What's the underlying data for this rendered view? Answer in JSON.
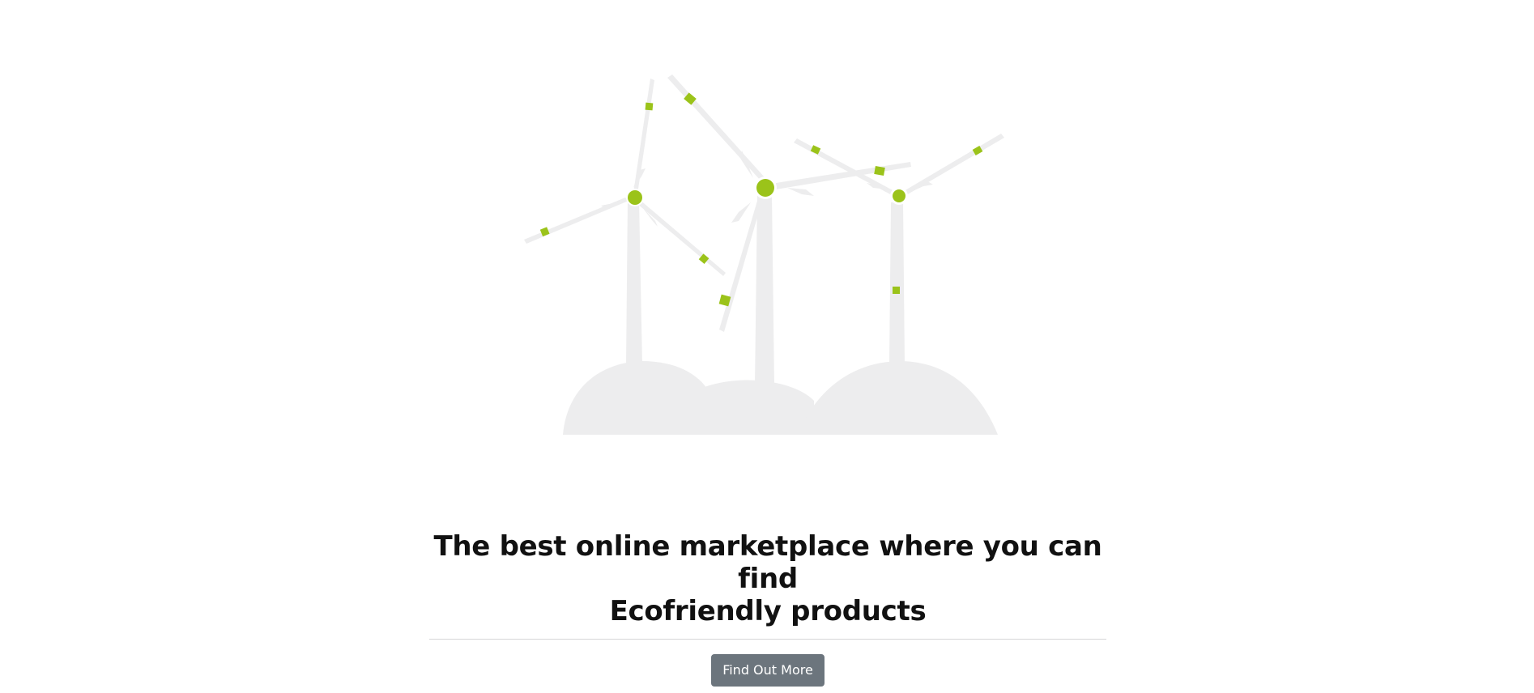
{
  "hero": {
    "headline_line1": "The best online marketplace where you can find",
    "headline_line2": "Ecofriendly products",
    "cta_label": "Find Out More"
  },
  "illustration": {
    "icon": "wind-turbines-illustration",
    "colors": {
      "turbine_gray": "#ededee",
      "accent_green": "#9bc31a"
    }
  },
  "colors": {
    "button_bg": "#6c757d",
    "heading_text": "#111111",
    "divider": "#d5d5d7"
  }
}
